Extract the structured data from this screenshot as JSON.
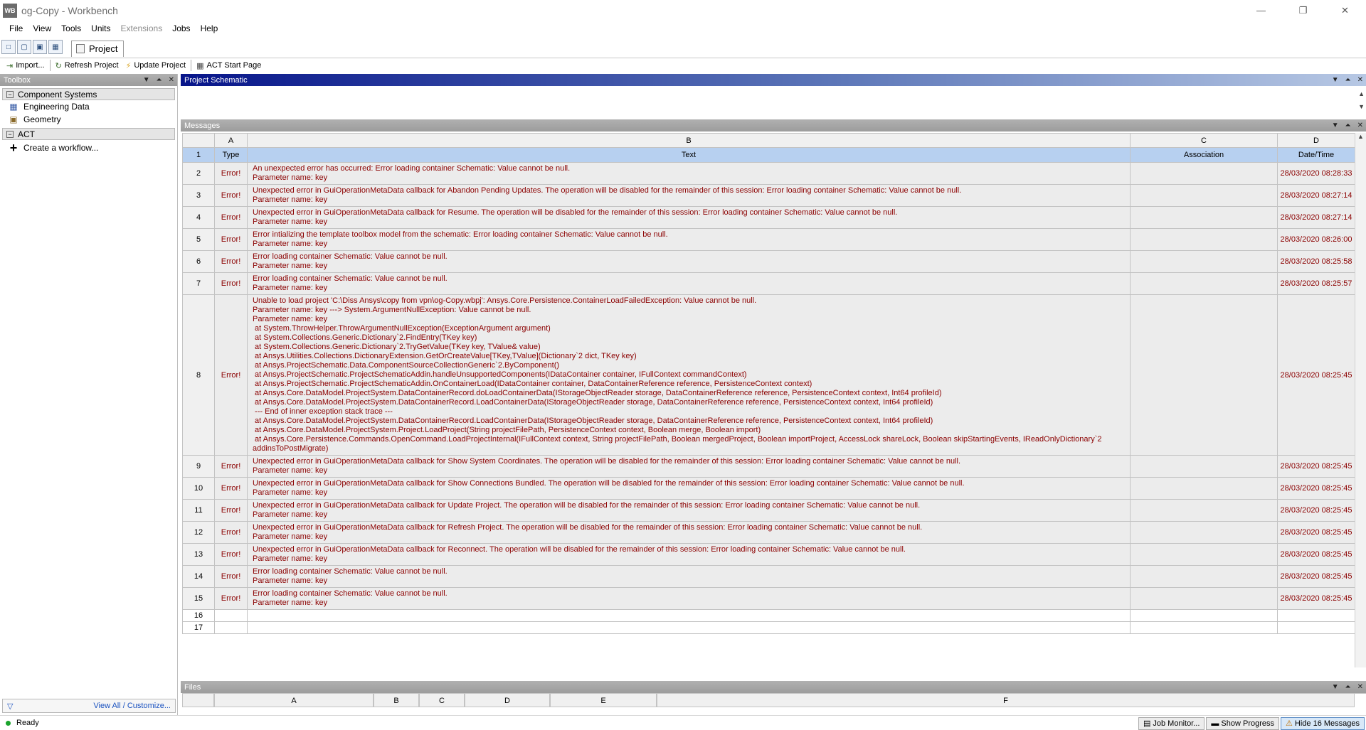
{
  "window": {
    "logo": "WB",
    "title": "og-Copy - Workbench"
  },
  "menu": [
    "File",
    "View",
    "Tools",
    "Units",
    "Extensions",
    "Jobs",
    "Help"
  ],
  "project_tab": "Project",
  "toolbar": {
    "import": "Import...",
    "refresh": "Refresh Project",
    "update": "Update Project",
    "act_start": "ACT Start Page"
  },
  "toolbox": {
    "title": "Toolbox",
    "group1": "Component Systems",
    "items": [
      "Engineering Data",
      "Geometry"
    ],
    "group2": "ACT",
    "create": "Create a workflow...",
    "footer_link": "View All / Customize..."
  },
  "schematic": {
    "title": "Project Schematic"
  },
  "messages": {
    "title": "Messages",
    "columns": [
      "A",
      "B",
      "C",
      "D"
    ],
    "headers": {
      "type": "Type",
      "text": "Text",
      "association": "Association",
      "datetime": "Date/Time"
    },
    "rows": [
      {
        "n": "2",
        "type": "Error!",
        "date": "28/03/2020 08:28:33",
        "text": "An unexpected error has occurred: Error loading container Schematic: Value cannot be null.\nParameter name: key"
      },
      {
        "n": "3",
        "type": "Error!",
        "date": "28/03/2020 08:27:14",
        "text": "Unexpected error in GuiOperationMetaData callback for Abandon Pending Updates. The operation will be disabled for the remainder of this session: Error loading container Schematic: Value cannot be null.\nParameter name: key"
      },
      {
        "n": "4",
        "type": "Error!",
        "date": "28/03/2020 08:27:14",
        "text": "Unexpected error in GuiOperationMetaData callback for Resume. The operation will be disabled for the remainder of this session: Error loading container Schematic: Value cannot be null.\nParameter name: key"
      },
      {
        "n": "5",
        "type": "Error!",
        "date": "28/03/2020 08:26:00",
        "text": "Error intializing the template toolbox model from the schematic: Error loading container Schematic: Value cannot be null.\nParameter name: key"
      },
      {
        "n": "6",
        "type": "Error!",
        "date": "28/03/2020 08:25:58",
        "text": "Error loading container Schematic: Value cannot be null.\nParameter name: key"
      },
      {
        "n": "7",
        "type": "Error!",
        "date": "28/03/2020 08:25:57",
        "text": "Error loading container Schematic: Value cannot be null.\nParameter name: key"
      },
      {
        "n": "8",
        "type": "Error!",
        "date": "28/03/2020 08:25:45",
        "text": "Unable to load project 'C:\\Diss Ansys\\copy from vpn\\og-Copy.wbpj': Ansys.Core.Persistence.ContainerLoadFailedException: Value cannot be null.\nParameter name: key ---> System.ArgumentNullException: Value cannot be null.\nParameter name: key\n at System.ThrowHelper.ThrowArgumentNullException(ExceptionArgument argument)\n at System.Collections.Generic.Dictionary`2.FindEntry(TKey key)\n at System.Collections.Generic.Dictionary`2.TryGetValue(TKey key, TValue& value)\n at Ansys.Utilities.Collections.DictionaryExtension.GetOrCreateValue[TKey,TValue](Dictionary`2 dict, TKey key)\n at Ansys.ProjectSchematic.Data.ComponentSourceCollectionGeneric`2.ByComponent()\n at Ansys.ProjectSchematic.ProjectSchematicAddin.handleUnsupportedComponents(IDataContainer container, IFullContext commandContext)\n at Ansys.ProjectSchematic.ProjectSchematicAddin.OnContainerLoad(IDataContainer container, DataContainerReference reference, PersistenceContext context)\n at Ansys.Core.DataModel.ProjectSystem.DataContainerRecord.doLoadContainerData(IStorageObjectReader storage, DataContainerReference reference, PersistenceContext context, Int64 profileId)\n at Ansys.Core.DataModel.ProjectSystem.DataContainerRecord.LoadContainerData(IStorageObjectReader storage, DataContainerReference reference, PersistenceContext context, Int64 profileId)\n --- End of inner exception stack trace ---\n at Ansys.Core.DataModel.ProjectSystem.DataContainerRecord.LoadContainerData(IStorageObjectReader storage, DataContainerReference reference, PersistenceContext context, Int64 profileId)\n at Ansys.Core.DataModel.ProjectSystem.Project.LoadProject(String projectFilePath, PersistenceContext context, Boolean merge, Boolean import)\n at Ansys.Core.Persistence.Commands.OpenCommand.LoadProjectInternal(IFullContext context, String projectFilePath, Boolean mergedProject, Boolean importProject, AccessLock shareLock, Boolean skipStartingEvents, IReadOnlyDictionary`2\naddinsToPostMigrate)"
      },
      {
        "n": "9",
        "type": "Error!",
        "date": "28/03/2020 08:25:45",
        "text": "Unexpected error in GuiOperationMetaData callback for Show System Coordinates. The operation will be disabled for the remainder of this session: Error loading container Schematic: Value cannot be null.\nParameter name: key"
      },
      {
        "n": "10",
        "type": "Error!",
        "date": "28/03/2020 08:25:45",
        "text": "Unexpected error in GuiOperationMetaData callback for Show Connections Bundled. The operation will be disabled for the remainder of this session: Error loading container Schematic: Value cannot be null.\nParameter name: key"
      },
      {
        "n": "11",
        "type": "Error!",
        "date": "28/03/2020 08:25:45",
        "text": "Unexpected error in GuiOperationMetaData callback for Update Project. The operation will be disabled for the remainder of this session: Error loading container Schematic: Value cannot be null.\nParameter name: key"
      },
      {
        "n": "12",
        "type": "Error!",
        "date": "28/03/2020 08:25:45",
        "text": "Unexpected error in GuiOperationMetaData callback for Refresh Project. The operation will be disabled for the remainder of this session: Error loading container Schematic: Value cannot be null.\nParameter name: key"
      },
      {
        "n": "13",
        "type": "Error!",
        "date": "28/03/2020 08:25:45",
        "text": "Unexpected error in GuiOperationMetaData callback for Reconnect. The operation will be disabled for the remainder of this session: Error loading container Schematic: Value cannot be null.\nParameter name: key"
      },
      {
        "n": "14",
        "type": "Error!",
        "date": "28/03/2020 08:25:45",
        "text": "Error loading container Schematic: Value cannot be null.\nParameter name: key"
      },
      {
        "n": "15",
        "type": "Error!",
        "date": "28/03/2020 08:25:45",
        "text": "Error loading container Schematic: Value cannot be null.\nParameter name: key"
      }
    ],
    "empty_rows": [
      "16",
      "17"
    ]
  },
  "files": {
    "title": "Files",
    "columns": [
      "A",
      "B",
      "C",
      "D",
      "E",
      "F"
    ]
  },
  "status": {
    "text": "Ready",
    "job_monitor": "Job Monitor...",
    "show_progress": "Show Progress",
    "hide_messages": "Hide 16 Messages"
  }
}
